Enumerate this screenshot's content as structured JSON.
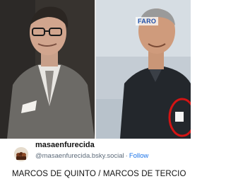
{
  "photos": {
    "left": {
      "description_icon": "person-photo"
    },
    "right": {
      "watermark": "FARO"
    }
  },
  "post": {
    "author_name": "masaenfurecida",
    "handle": "@masaenfurecida.bsky.social",
    "separator": "·",
    "follow_label": "Follow",
    "text": "MARCOS DE QUINTO / MARCOS DE TERCIO"
  },
  "colors": {
    "follow": "#1a73e8",
    "handle": "#5d6b7a",
    "annotation_circle": "#d41414"
  }
}
